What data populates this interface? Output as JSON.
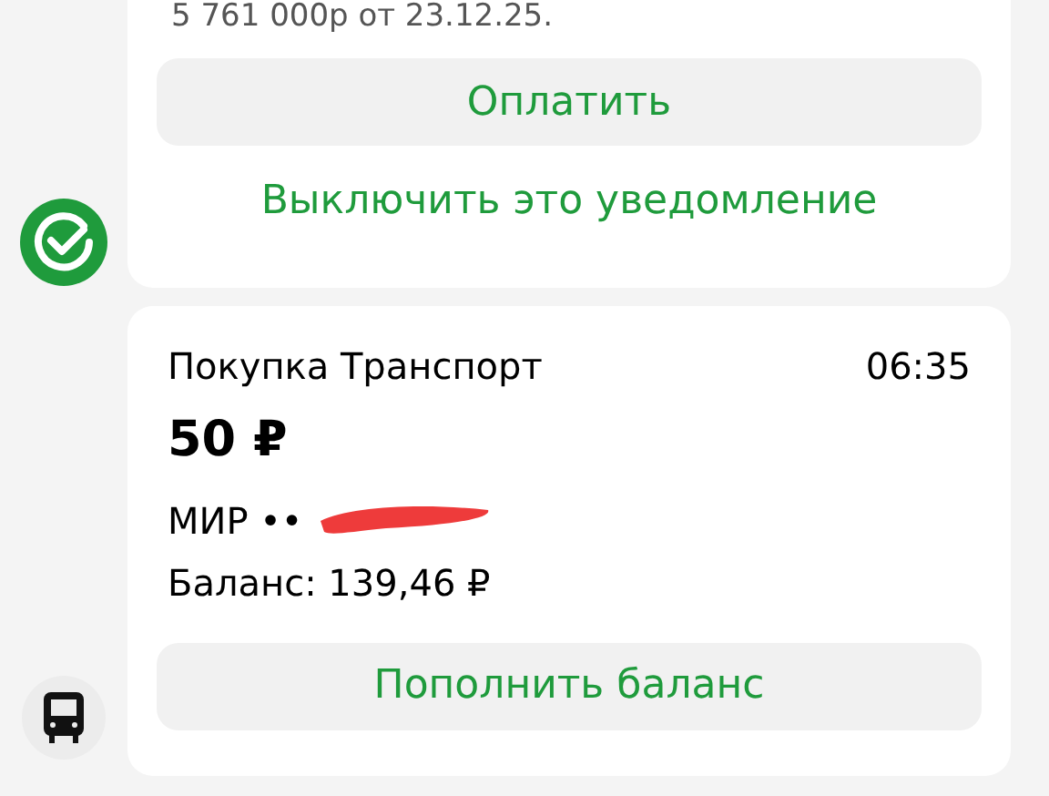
{
  "payment_notice": {
    "cut_text": "5 761 000р от 23.12.25.",
    "pay_button": "Оплатить",
    "disable_link": "Выключить это уведомление"
  },
  "transaction": {
    "title": "Покупка Транспорт",
    "time": "06:35",
    "amount": "50 ₽",
    "card": "МИР ••",
    "balance": "Баланс: 139,46 ₽",
    "top_up_button": "Пополнить баланс"
  }
}
